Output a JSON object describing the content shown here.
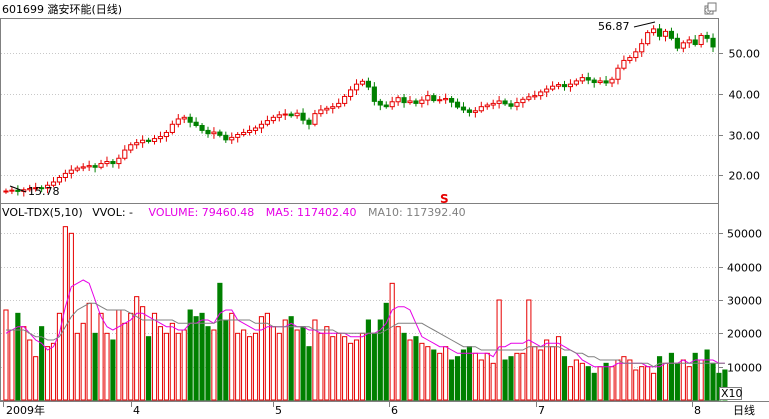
{
  "header": {
    "title": "601699 潞安环能(日线)",
    "window_icons": [
      "diamond-icon",
      "restore-icon"
    ]
  },
  "volume_header": {
    "indicator": "VOL-TDX(5,10)",
    "vvol": "VVOL: -",
    "volume": "VOLUME: 79460.48",
    "ma5": "MA5: 117402.40",
    "ma10": "MA10: 117392.40"
  },
  "annotations": {
    "high_label": "56.87",
    "low_label": "15.78",
    "marker_symbol": "S"
  },
  "x_axis": {
    "labels": [
      "2009年",
      "4",
      "5",
      "6",
      "7",
      "8",
      "日线"
    ]
  },
  "volume_unit": "X10",
  "colors": {
    "up": "#e60000",
    "down": "#008000",
    "ma5": "#e600e6",
    "ma10": "#808080",
    "grid": "#c8c8c8",
    "axis_text": "#000000"
  },
  "chart_data": [
    {
      "type": "candlestick",
      "title": "601699 潞安环能(日线)",
      "yticks": [
        20.0,
        30.0,
        40.0,
        50.0
      ],
      "ylim": [
        14,
        57
      ],
      "grid": true,
      "max": 56.87,
      "min": 15.78,
      "closes": [
        16.2,
        16.4,
        16.1,
        16.5,
        16.8,
        17.0,
        16.9,
        17.6,
        18.4,
        19.5,
        20.5,
        21.3,
        21.8,
        22.1,
        22.4,
        22.0,
        22.9,
        23.4,
        22.9,
        24.2,
        26.2,
        27.5,
        28.0,
        28.6,
        28.3,
        29.0,
        29.5,
        30.5,
        32.5,
        33.8,
        34.2,
        33.0,
        32.2,
        31.0,
        30.2,
        30.6,
        29.8,
        28.7,
        29.3,
        30.0,
        30.5,
        31.0,
        31.6,
        32.5,
        33.4,
        34.2,
        34.8,
        35.0,
        34.6,
        35.2,
        33.5,
        32.5,
        35.1,
        36.0,
        36.4,
        36.8,
        37.6,
        39.3,
        40.9,
        42.3,
        43.0,
        41.6,
        38.1,
        37.2,
        36.8,
        38.0,
        39.0,
        37.8,
        38.2,
        37.6,
        38.4,
        39.5,
        38.3,
        38.5,
        38.8,
        37.9,
        36.7,
        36.0,
        35.4,
        35.8,
        36.8,
        37.2,
        37.6,
        38.2,
        37.5,
        36.9,
        37.8,
        38.6,
        39.2,
        39.5,
        40.4,
        41.1,
        41.8,
        42.2,
        41.7,
        42.3,
        43.1,
        43.9,
        43.3,
        42.7,
        43.1,
        42.6,
        43.5,
        46.2,
        48.1,
        48.8,
        50.2,
        52.2,
        54.9,
        55.8,
        54.0,
        55.2,
        53.5,
        51.1,
        52.4,
        53.1,
        52.0,
        54.2,
        53.5,
        51.4
      ],
      "opens": [
        16.0,
        16.2,
        16.4,
        16.1,
        16.5,
        16.8,
        17.0,
        16.9,
        17.6,
        18.4,
        19.5,
        20.5,
        21.3,
        21.8,
        22.1,
        22.4,
        22.0,
        22.9,
        23.4,
        22.9,
        24.2,
        26.2,
        27.5,
        28.0,
        28.6,
        28.3,
        29.0,
        29.5,
        30.5,
        32.5,
        33.8,
        34.2,
        33.0,
        32.2,
        31.0,
        30.2,
        30.6,
        29.8,
        28.7,
        29.3,
        30.0,
        30.5,
        31.0,
        31.6,
        32.5,
        33.4,
        34.2,
        34.8,
        35.0,
        34.6,
        35.2,
        33.5,
        32.5,
        35.1,
        36.0,
        36.4,
        36.8,
        37.6,
        39.3,
        40.9,
        42.3,
        43.0,
        41.6,
        38.1,
        37.2,
        36.8,
        38.0,
        39.0,
        37.8,
        38.2,
        37.6,
        38.4,
        39.5,
        38.3,
        38.5,
        38.8,
        37.9,
        36.7,
        36.0,
        35.4,
        35.8,
        36.8,
        37.2,
        37.6,
        38.2,
        37.5,
        36.9,
        37.8,
        38.6,
        39.2,
        39.5,
        40.4,
        41.1,
        41.8,
        42.2,
        41.7,
        42.3,
        43.1,
        43.9,
        43.3,
        42.7,
        43.1,
        42.6,
        43.5,
        46.2,
        48.1,
        48.8,
        50.2,
        52.2,
        54.9,
        55.8,
        54.0,
        55.2,
        53.5,
        51.1,
        52.4,
        53.1,
        52.0,
        54.2,
        53.5
      ]
    },
    {
      "type": "bar",
      "title": "VOL-TDX(5,10)",
      "yticks": [
        10000,
        20000,
        30000,
        40000,
        50000
      ],
      "ylim": [
        0,
        57000
      ],
      "grid": true,
      "values": [
        27000,
        21000,
        26000,
        22000,
        18000,
        13000,
        22000,
        16000,
        17000,
        26000,
        52000,
        50000,
        20000,
        23000,
        29000,
        20000,
        26000,
        20000,
        18000,
        27000,
        23000,
        26000,
        31000,
        28000,
        19000,
        26000,
        22000,
        20000,
        23000,
        20000,
        21000,
        27000,
        25000,
        26000,
        22000,
        21000,
        35000,
        24000,
        26000,
        20000,
        21000,
        19000,
        20000,
        25000,
        26000,
        22000,
        20000,
        24000,
        25000,
        21000,
        22000,
        16000,
        24000,
        20000,
        22000,
        19000,
        20000,
        19000,
        17000,
        18000,
        20000,
        24000,
        20000,
        24000,
        29000,
        35000,
        22000,
        20000,
        18000,
        19000,
        17000,
        16000,
        15000,
        14000,
        16000,
        12000,
        13000,
        15000,
        16000,
        14000,
        12000,
        14000,
        11000,
        30000,
        12000,
        13000,
        14000,
        14000,
        30000,
        16000,
        15000,
        18000,
        16000,
        19000,
        13000,
        10000,
        12000,
        11000,
        10000,
        8000,
        10000,
        11000,
        10000,
        12000,
        13000,
        12000,
        9000,
        10000,
        10000,
        8000,
        13000,
        11000,
        14000,
        11000,
        12000,
        10000,
        14000,
        12000,
        15000,
        11000,
        8000,
        9000
      ],
      "ma5": [
        20000,
        21000,
        22000,
        22000,
        20000,
        18000,
        17000,
        15000,
        16000,
        20000,
        28000,
        34000,
        35000,
        36000,
        35000,
        30000,
        25000,
        22000,
        21000,
        22000,
        23000,
        24000,
        26000,
        26000,
        25000,
        24000,
        23000,
        22000,
        22000,
        21000,
        21000,
        23000,
        23000,
        24000,
        24000,
        23000,
        26000,
        27000,
        27000,
        24000,
        23000,
        22000,
        21000,
        21000,
        22000,
        22000,
        22000,
        22000,
        23000,
        22000,
        22000,
        21000,
        21000,
        20000,
        20000,
        20000,
        20000,
        20000,
        19000,
        19000,
        19000,
        20000,
        20000,
        21000,
        23000,
        27000,
        28000,
        28000,
        27000,
        23000,
        19000,
        18000,
        17000,
        16000,
        16000,
        15000,
        14000,
        14000,
        14000,
        14000,
        14000,
        14000,
        13000,
        16000,
        16000,
        17000,
        17000,
        17000,
        18000,
        17000,
        16000,
        17000,
        17000,
        17000,
        16000,
        15000,
        14000,
        12000,
        11000,
        10000,
        10000,
        10000,
        10000,
        11000,
        11000,
        11000,
        11000,
        11000,
        10000,
        10000,
        10000,
        11000,
        11000,
        11000,
        12000,
        11000,
        12000,
        12000,
        12000,
        12000,
        11000,
        11000
      ],
      "ma10": [
        21000,
        21000,
        21000,
        21000,
        20000,
        19000,
        19000,
        18000,
        18000,
        19000,
        22000,
        25000,
        27000,
        28000,
        29000,
        29000,
        28000,
        27000,
        27000,
        27000,
        27000,
        26000,
        25000,
        24000,
        24000,
        24000,
        24000,
        24000,
        24000,
        23000,
        23000,
        23000,
        23000,
        23000,
        23000,
        23000,
        24000,
        24000,
        24000,
        24000,
        24000,
        24000,
        23000,
        23000,
        23000,
        22000,
        22000,
        22000,
        22000,
        22000,
        22000,
        22000,
        21000,
        21000,
        21000,
        21000,
        20000,
        20000,
        20000,
        20000,
        20000,
        20000,
        20000,
        20000,
        21000,
        22000,
        23000,
        23000,
        23000,
        23000,
        23000,
        22000,
        21000,
        20000,
        19000,
        18000,
        17000,
        16000,
        16000,
        16000,
        15000,
        15000,
        15000,
        15000,
        15000,
        15000,
        15000,
        15000,
        16000,
        16000,
        16000,
        16000,
        16000,
        16000,
        15000,
        15000,
        14000,
        14000,
        13000,
        13000,
        12000,
        12000,
        12000,
        12000,
        11000,
        11000,
        11000,
        11000,
        11000,
        10000,
        11000,
        11000,
        11000,
        11000,
        11000,
        11000,
        11000,
        11000,
        11000,
        11000,
        11000,
        11000
      ]
    }
  ]
}
